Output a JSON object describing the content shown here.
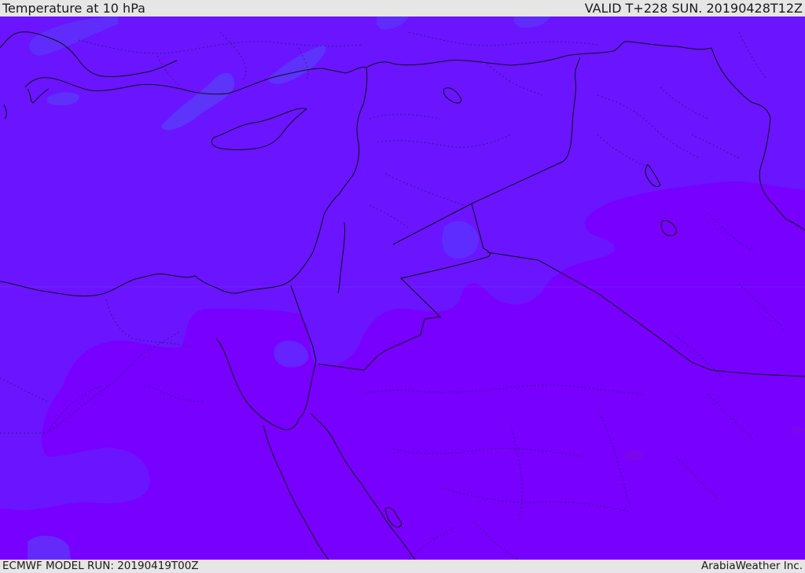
{
  "header": {
    "title": "Temperature at 10 hPa",
    "valid_time": "VALID T+228 SUN. 20190428T12Z"
  },
  "footer": {
    "model_run": "ECMWF MODEL RUN: 20190419T00Z",
    "credit": "ArabiaWeather Inc."
  },
  "map": {
    "field": "temperature",
    "colors": {
      "cold_band": "#6a14ff",
      "cool_band": "#5f2cff",
      "cold_patch": "#5a3cf8",
      "warm_band": "#7800ff",
      "warm_spot": "#7d05ee",
      "frame": "#e6e6e6"
    }
  }
}
